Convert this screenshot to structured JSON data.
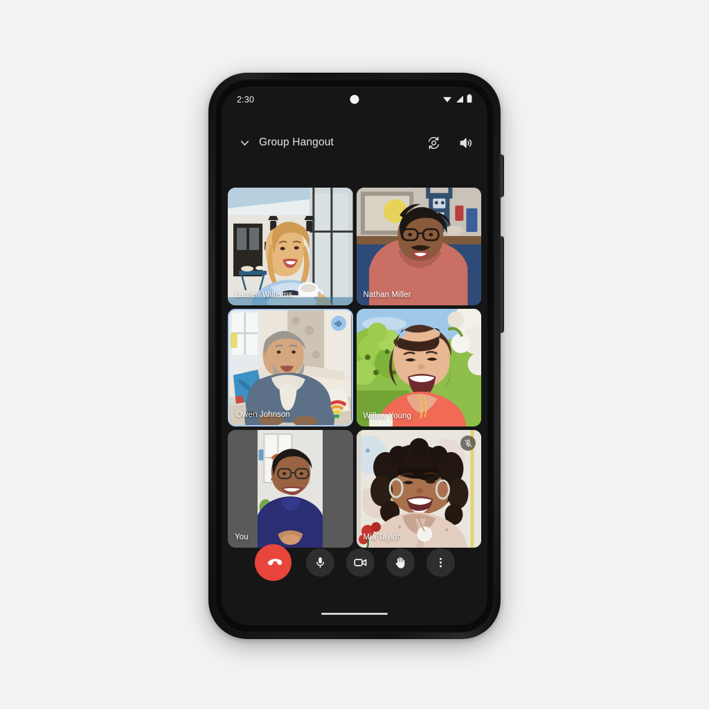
{
  "status_bar": {
    "time": "2:30",
    "icons": [
      "wifi-icon",
      "cellular-signal-icon",
      "battery-icon"
    ]
  },
  "header": {
    "collapse_icon": "chevron-down-icon",
    "title": "Group Hangout",
    "actions": [
      {
        "name": "flip-camera",
        "icon": "flip-camera-icon"
      },
      {
        "name": "speaker",
        "icon": "speaker-volume-icon"
      }
    ]
  },
  "grid": {
    "participants": [
      {
        "name": "Lauren Williams",
        "speaking": false,
        "muted": false,
        "self": false,
        "scene": "blonde-woman-denim-jacket-coffee-patio"
      },
      {
        "name": "Nathan Miller",
        "speaking": false,
        "muted": false,
        "self": false,
        "scene": "man-glasses-mustache-red-sweater-livingroom"
      },
      {
        "name": "Owen Johnson",
        "speaking": true,
        "muted": false,
        "self": false,
        "badge_icon": "audio-waveform-icon",
        "scene": "grey-haired-man-sofa-pillows"
      },
      {
        "name": "Willow Young",
        "speaking": false,
        "muted": false,
        "self": false,
        "scene": "brunette-woman-coral-top-garden"
      },
      {
        "name": "You",
        "speaking": false,
        "muted": false,
        "self": true,
        "scene": "man-glasses-navy-sweater-portrait"
      },
      {
        "name": "Mia Taylor",
        "speaking": false,
        "muted": true,
        "self": false,
        "badge_icon": "microphone-off-icon",
        "scene": "curly-hair-woman-blush-jacket"
      }
    ]
  },
  "controls": [
    {
      "name": "end-call",
      "label": "End call",
      "icon": "phone-hangup-icon",
      "color": "#e8453c"
    },
    {
      "name": "microphone",
      "label": "Mute",
      "icon": "microphone-icon",
      "color": "#2e2e2e"
    },
    {
      "name": "camera",
      "label": "Camera",
      "icon": "video-camera-icon",
      "color": "#2e2e2e"
    },
    {
      "name": "raise-hand",
      "label": "Raise hand",
      "icon": "raised-hand-icon",
      "color": "#2e2e2e"
    },
    {
      "name": "more-options",
      "label": "More options",
      "icon": "more-vertical-icon",
      "color": "#2e2e2e"
    }
  ],
  "theme": {
    "page_background": "#f2f2f0",
    "screen_background": "#161616",
    "accent_end_call": "#e8453c",
    "speaking_border": "#a8cdf5",
    "text_primary": "#e6e6e6"
  }
}
